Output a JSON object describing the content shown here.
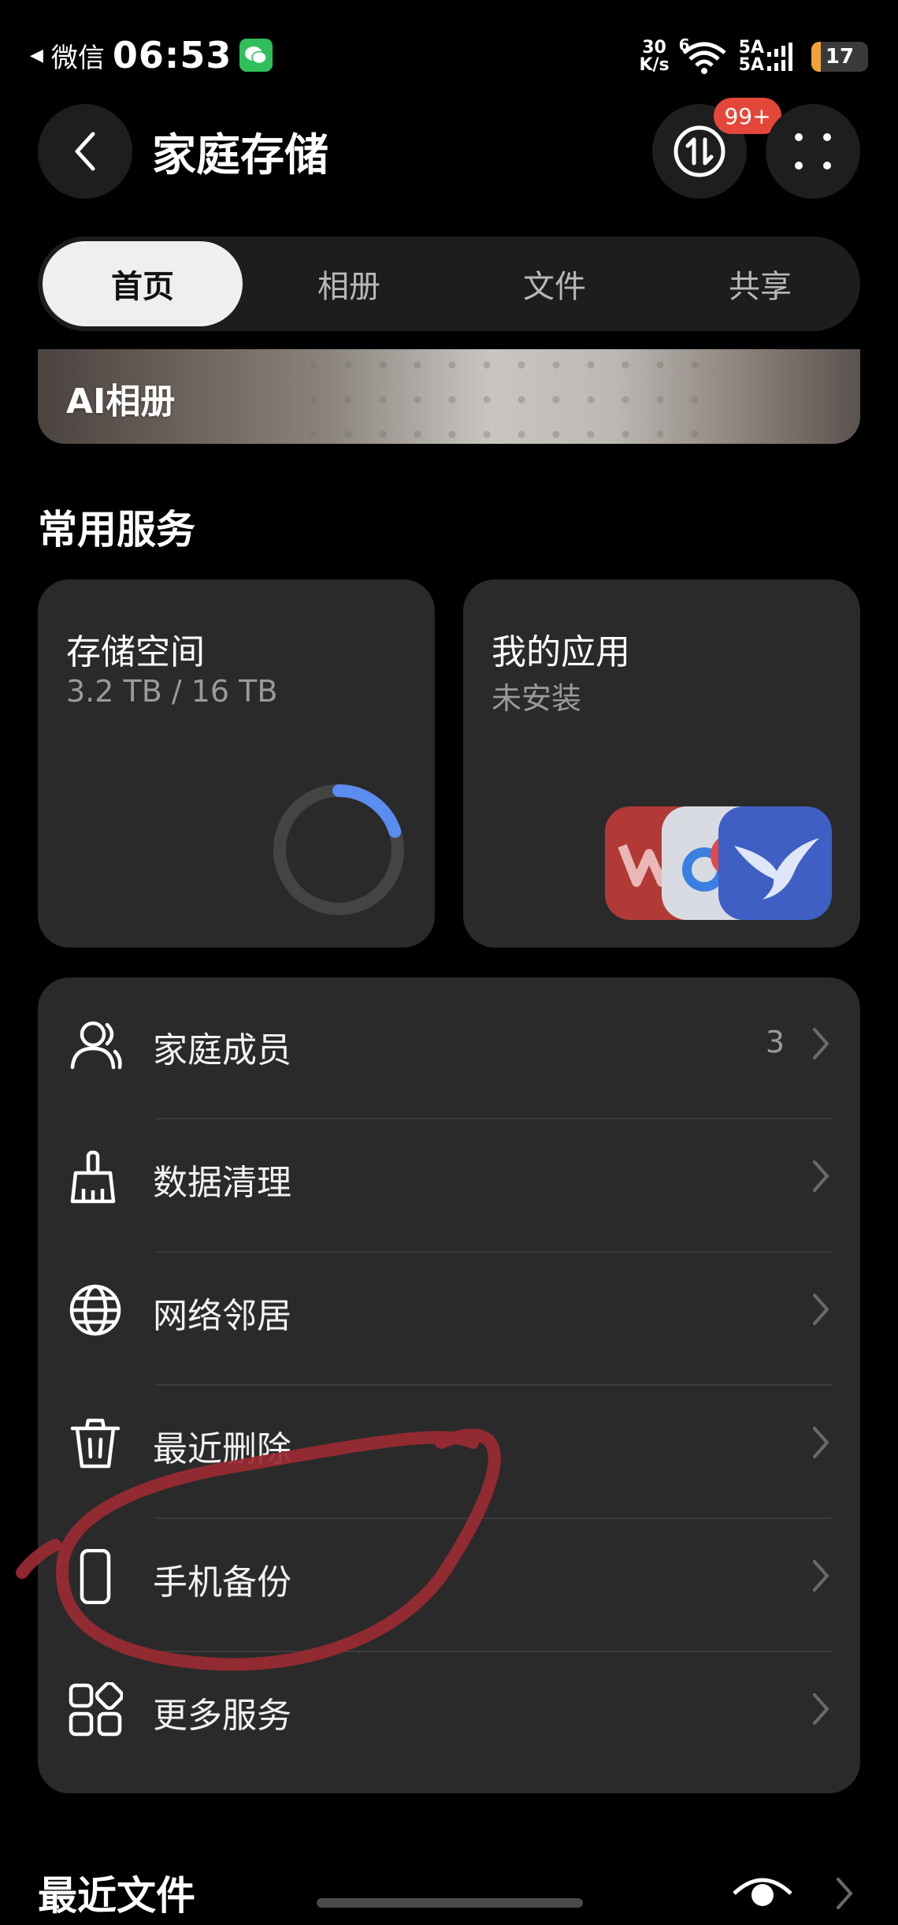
{
  "status_bar": {
    "back_app": "微信",
    "time": "06:53",
    "speed_value": "30",
    "speed_unit": "K/s",
    "wifi_badge": "6",
    "sim1": "5A",
    "sim2": "5A",
    "battery": "17",
    "battery_level_percent": 17
  },
  "header": {
    "title": "家庭存储",
    "badge": "99+"
  },
  "tabs": [
    {
      "label": "首页",
      "active": true
    },
    {
      "label": "相册",
      "active": false
    },
    {
      "label": "文件",
      "active": false
    },
    {
      "label": "共享",
      "active": false
    }
  ],
  "banner": {
    "title": "AI相册"
  },
  "common_services": {
    "title": "常用服务",
    "storage": {
      "title": "存储空间",
      "usage": "3.2 TB / 16 TB",
      "used_fraction": 0.2
    },
    "apps": {
      "title": "我的应用",
      "status": "未安装"
    }
  },
  "menu": {
    "items": [
      {
        "label": "家庭成员",
        "count": "3",
        "icon": "person-icon"
      },
      {
        "label": "数据清理",
        "count": "",
        "icon": "broom-icon"
      },
      {
        "label": "网络邻居",
        "count": "",
        "icon": "globe-icon"
      },
      {
        "label": "最近删除",
        "count": "",
        "icon": "trash-icon"
      },
      {
        "label": "手机备份",
        "count": "",
        "icon": "phone-icon"
      },
      {
        "label": "更多服务",
        "count": "",
        "icon": "grid-icon"
      }
    ]
  },
  "recent_files": {
    "title": "最近文件"
  },
  "colors": {
    "background": "#000000",
    "card": "#2a2a2a",
    "accent_blue": "#5b8cf0",
    "badge_red": "#e4473a",
    "annotation_red": "#9b2a32"
  }
}
